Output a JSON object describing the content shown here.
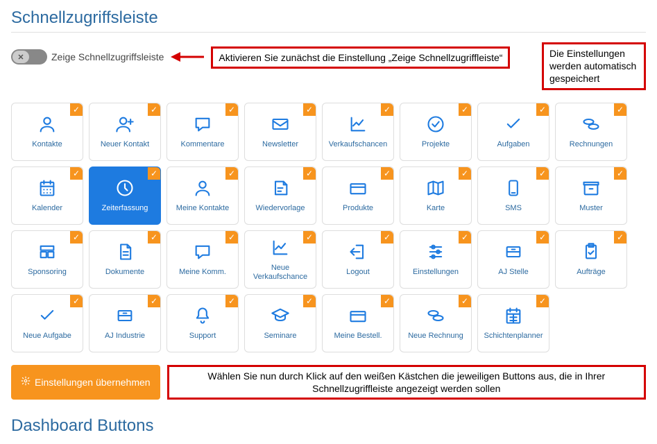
{
  "titles": {
    "main": "Schnellzugriffsleiste",
    "second": "Dashboard Buttons"
  },
  "toggle": {
    "label": "Zeige Schnellzugriffsleiste",
    "on": false
  },
  "annotations": {
    "activate": "Aktivieren Sie zunächst die Einstellung „Zeige Schnellzugriffleiste“",
    "autosave": "Die Einstellungen werden automatisch gespeichert",
    "select_tiles": "Wählen Sie nun durch Klick auf den weißen Kästchen die jeweiligen Buttons aus, die in Ihrer Schnellzugriffleiste angezeigt werden sollen"
  },
  "apply_button": "Einstellungen übernehmen",
  "tiles": [
    {
      "label": "Kontakte",
      "icon": "person-icon",
      "checked": true,
      "active": false
    },
    {
      "label": "Neuer Kontakt",
      "icon": "person-plus-icon",
      "checked": true,
      "active": false
    },
    {
      "label": "Kommentare",
      "icon": "comment-icon",
      "checked": true,
      "active": false
    },
    {
      "label": "Newsletter",
      "icon": "envelope-icon",
      "checked": true,
      "active": false
    },
    {
      "label": "Verkaufschancen",
      "icon": "chart-line-icon",
      "checked": true,
      "active": false
    },
    {
      "label": "Projekte",
      "icon": "circle-check-icon",
      "checked": true,
      "active": false
    },
    {
      "label": "Aufgaben",
      "icon": "check-icon",
      "checked": true,
      "active": false
    },
    {
      "label": "Rechnungen",
      "icon": "coins-icon",
      "checked": true,
      "active": false
    },
    {
      "label": "Kalender",
      "icon": "calendar-icon",
      "checked": true,
      "active": false
    },
    {
      "label": "Zeiterfassung",
      "icon": "clock-icon",
      "checked": true,
      "active": true
    },
    {
      "label": "Meine Kontakte",
      "icon": "person-icon",
      "checked": true,
      "active": false
    },
    {
      "label": "Wiedervorlage",
      "icon": "note-icon",
      "checked": true,
      "active": false
    },
    {
      "label": "Produkte",
      "icon": "card-icon",
      "checked": true,
      "active": false
    },
    {
      "label": "Karte",
      "icon": "map-icon",
      "checked": true,
      "active": false
    },
    {
      "label": "SMS",
      "icon": "phone-icon",
      "checked": true,
      "active": false
    },
    {
      "label": "Muster",
      "icon": "archive-icon",
      "checked": true,
      "active": false
    },
    {
      "label": "Sponsoring",
      "icon": "list-icon",
      "checked": true,
      "active": false
    },
    {
      "label": "Dokumente",
      "icon": "document-icon",
      "checked": true,
      "active": false
    },
    {
      "label": "Meine Komm.",
      "icon": "comment-icon",
      "checked": true,
      "active": false
    },
    {
      "label": "Neue Verkaufschance",
      "icon": "chart-line-icon",
      "checked": true,
      "active": false
    },
    {
      "label": "Logout",
      "icon": "logout-icon",
      "checked": true,
      "active": false
    },
    {
      "label": "Einstellungen",
      "icon": "sliders-icon",
      "checked": true,
      "active": false
    },
    {
      "label": "AJ Stelle",
      "icon": "drawer-icon",
      "checked": true,
      "active": false
    },
    {
      "label": "Aufträge",
      "icon": "clipboard-check-icon",
      "checked": true,
      "active": false
    },
    {
      "label": "Neue Aufgabe",
      "icon": "check-icon",
      "checked": true,
      "active": false
    },
    {
      "label": "AJ Industrie",
      "icon": "drawer-icon",
      "checked": true,
      "active": false
    },
    {
      "label": "Support",
      "icon": "bell-icon",
      "checked": true,
      "active": false
    },
    {
      "label": "Seminare",
      "icon": "graduation-icon",
      "checked": true,
      "active": false
    },
    {
      "label": "Meine Bestell.",
      "icon": "card-icon",
      "checked": true,
      "active": false
    },
    {
      "label": "Neue Rechnung",
      "icon": "coins-icon",
      "checked": true,
      "active": false
    },
    {
      "label": "Schichtenplanner",
      "icon": "calendar-grid-icon",
      "checked": true,
      "active": false
    }
  ],
  "icons": {
    "person-icon": "<circle cx='12' cy='8' r='4'/><path d='M4 21c0-4 4-6 8-6s8 2 8 6'/>",
    "person-plus-icon": "<circle cx='10' cy='8' r='4'/><path d='M2 21c0-4 4-6 8-6s8 2 8 6'/><path d='M19 6v6M16 9h6'/>",
    "comment-icon": "<path d='M4 5h16v11H12l-5 4v-4H4z'/>",
    "envelope-icon": "<rect x='3' y='6' width='18' height='12' rx='1'/><path d='M3 8l9 6 9-6'/>",
    "chart-line-icon": "<path d='M4 4v16h16'/><path d='M6 14l4-4 3 3 5-6'/>",
    "circle-check-icon": "<circle cx='12' cy='12' r='9'/><path d='M8 12l3 3 5-6'/>",
    "check-icon": "<path d='M5 12l4 4 10-10'/>",
    "coins-icon": "<ellipse cx='9' cy='9' rx='6' ry='3'/><ellipse cx='15' cy='15' rx='6' ry='3'/>",
    "calendar-icon": "<rect x='4' y='5' width='16' height='16' rx='1'/><path d='M4 10h16M8 3v4M16 3v4'/><path d='M8 14h0M12 14h0M16 14h0M8 18h0M12 18h0M16 18h0'/>",
    "clock-icon": "<circle cx='12' cy='12' r='9'/><path d='M12 7v5l3 3'/>",
    "note-icon": "<path d='M6 4h10l4 4v12H6z'/><path d='M16 4v4h4'/><path d='M9 12h6M9 16h4'/>",
    "card-icon": "<rect x='3' y='7' width='18' height='12' rx='1'/><path d='M3 11h18'/>",
    "map-icon": "<path d='M9 4l-6 2v14l6-2 6 2 6-2V4l-6 2-6-2z'/><path d='M9 4v14M15 6v14'/>",
    "phone-icon": "<rect x='7' y='3' width='10' height='18' rx='2'/><path d='M10 18h4'/>",
    "archive-icon": "<rect x='4' y='8' width='16' height='12' rx='1'/><rect x='3' y='5' width='18' height='3'/><path d='M10 13h4'/>",
    "list-icon": "<rect x='4' y='5' width='16' height='5'/><rect x='4' y='12' width='7' height='7'/><rect x='13' y='12' width='7' height='7'/>",
    "document-icon": "<path d='M7 3h8l4 4v14H7z'/><path d='M15 3v4h4'/><path d='M10 12h6M10 16h6'/>",
    "logout-icon": "<path d='M10 4h8v16h-8'/><path d='M14 12H3M7 8l-4 4 4 4'/>",
    "sliders-icon": "<path d='M5 6h14M5 12h14M5 18h14'/><circle cx='9' cy='6' r='2'/><circle cx='15' cy='12' r='2'/><circle cx='9' cy='18' r='2'/>",
    "drawer-icon": "<rect x='4' y='6' width='16' height='12' rx='1'/><path d='M4 12h16'/><path d='M10 9h4'/>",
    "clipboard-check-icon": "<rect x='6' y='4' width='12' height='16' rx='1'/><rect x='9' y='2' width='6' height='4'/><path d='M9 13l2 2 4-4'/>",
    "bell-icon": "<path d='M12 3a5 5 0 0 1 5 5v4l2 3H5l2-3V8a5 5 0 0 1 5-5z'/><path d='M10 19a2 2 0 0 0 4 0'/>",
    "graduation-icon": "<path d='M2 9l10-5 10 5-10 5z'/><path d='M6 11v4c0 2 3 3 6 3s6-1 6-3v-4'/>",
    "calendar-grid-icon": "<rect x='4' y='5' width='16' height='16' rx='1'/><path d='M4 10h16M8 3v4M16 3v4M8 14h8M8 18h8M12 10v11'/>"
  },
  "colors": {
    "accent": "#1e7be0",
    "title": "#2c6aa0",
    "orange": "#f7941e",
    "annotation_border": "#d40000"
  }
}
